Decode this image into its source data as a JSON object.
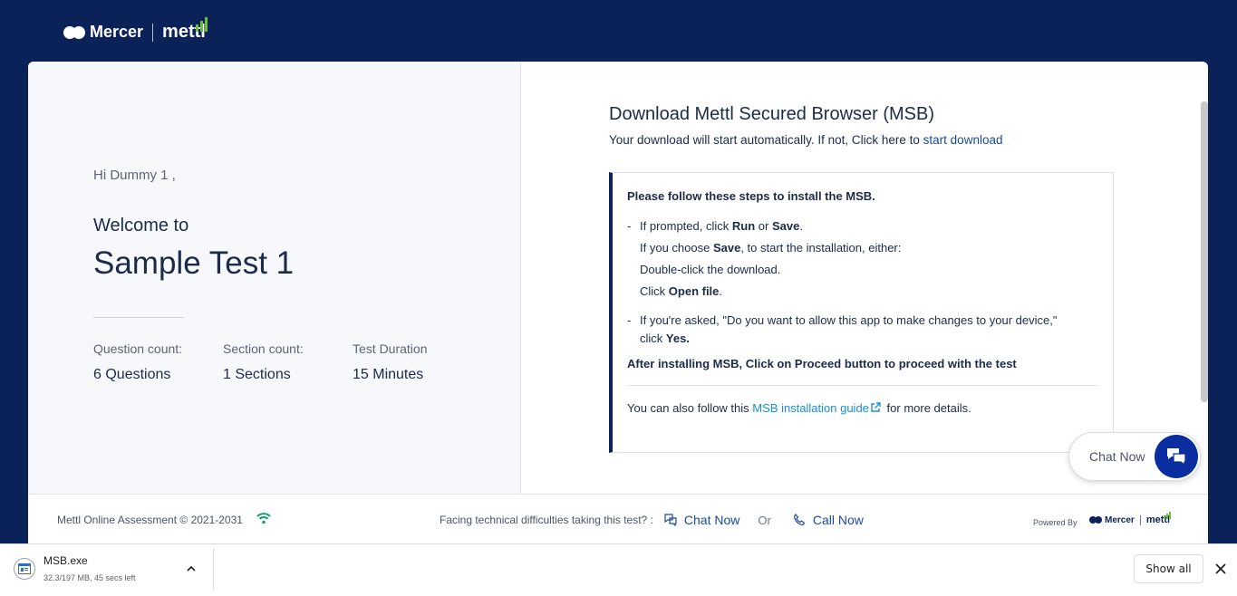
{
  "header": {
    "logo_mercer": "Mercer",
    "logo_mettl": "mettl"
  },
  "welcome": {
    "greeting": "Hi Dummy 1 ,",
    "welcome_to": "Welcome to",
    "test_name": "Sample Test 1"
  },
  "stats": [
    {
      "label": "Question count:",
      "value": "6 Questions"
    },
    {
      "label": "Section count:",
      "value": "1 Sections"
    },
    {
      "label": "Test Duration",
      "value": "15  Minutes"
    }
  ],
  "download": {
    "title": "Download Mettl Secured Browser (MSB)",
    "subtitle_prefix": "Your download will start automatically. If not, Click here to ",
    "start_link": "start download"
  },
  "steps": {
    "heading": "Please follow these steps to install the MSB.",
    "s1_prefix": "If prompted, click ",
    "s1_run": "Run",
    "s1_or": " or ",
    "s1_save": "Save",
    "s1_end": ".",
    "s1b_prefix": "If you choose ",
    "s1b_save": "Save",
    "s1b_suffix": ", to start the installation, either:",
    "s1c": "Double-click the download.",
    "s1d_prefix": "Click ",
    "s1d_bold": "Open file",
    "s1d_end": ".",
    "s2_line1": "If you're asked, \"Do you want to allow this app to make changes to your device,\"",
    "s2_prefix": "click ",
    "s2_bold": "Yes.",
    "after": "After installing MSB, Click on Proceed button to proceed with the test",
    "guide_prefix": "You can also follow this ",
    "guide_link": "MSB installation guide",
    "guide_suffix": " for more details."
  },
  "chat_float": {
    "label": "Chat Now"
  },
  "footer": {
    "copyright": "Mettl Online Assessment © 2021-2031",
    "question": "Facing technical difficulties taking this test? :",
    "chat_now": "Chat Now",
    "or": "Or",
    "call_now": "Call Now",
    "powered_by": "Powered By",
    "logo_mercer": "Mercer",
    "logo_mettl": "mettl"
  },
  "download_bar": {
    "file_name": "MSB.exe",
    "status": "32.3/197 MB, 45 secs left",
    "show_all": "Show all"
  },
  "colors": {
    "navy": "#0a2257",
    "link": "#1a8fd6",
    "chat_button": "#0a2ea0",
    "wifi": "#1a9e6e"
  }
}
